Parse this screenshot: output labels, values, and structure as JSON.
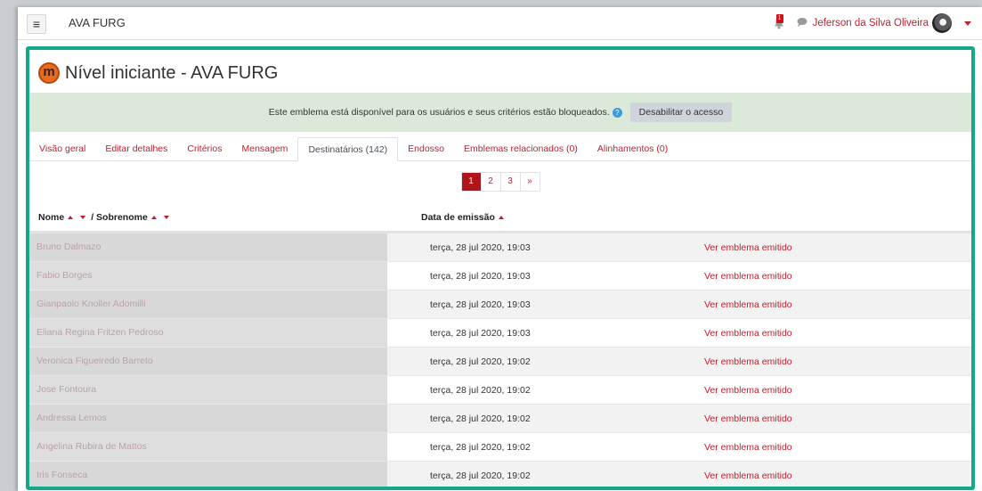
{
  "navbar": {
    "site_name": "AVA FURG",
    "notification_count": "1",
    "user_name": "Jeferson da Silva Oliveira"
  },
  "header": {
    "title": "Nível iniciante - AVA FURG"
  },
  "alert": {
    "message": "Este emblema está disponível para os usuários e seus critérios estão bloqueados.",
    "button_label": "Desabilitar o acesso"
  },
  "tabs": [
    {
      "label": "Visão geral"
    },
    {
      "label": "Editar detalhes"
    },
    {
      "label": "Critérios"
    },
    {
      "label": "Mensagem"
    },
    {
      "label": "Destinatários (142)",
      "active": true
    },
    {
      "label": "Endosso"
    },
    {
      "label": "Emblemas relacionados (0)"
    },
    {
      "label": "Alinhamentos (0)"
    }
  ],
  "pagination": {
    "pages": [
      "1",
      "2",
      "3"
    ],
    "next": "»",
    "current": "1"
  },
  "table": {
    "col_nome": "Nome",
    "col_sobrenome": "/ Sobrenome",
    "col_date": "Data de emissão",
    "rows": [
      {
        "name": "Bruno Dalmazo",
        "date": "terça, 28 jul 2020, 19:03",
        "link": "Ver emblema emitido"
      },
      {
        "name": "Fabio Borges",
        "date": "terça, 28 jul 2020, 19:03",
        "link": "Ver emblema emitido"
      },
      {
        "name": "Gianpaolo Knoller Adomilli",
        "date": "terça, 28 jul 2020, 19:03",
        "link": "Ver emblema emitido"
      },
      {
        "name": "Eliana Regina Fritzen Pedroso",
        "date": "terça, 28 jul 2020, 19:03",
        "link": "Ver emblema emitido"
      },
      {
        "name": "Veronica Figueiredo Barreto",
        "date": "terça, 28 jul 2020, 19:02",
        "link": "Ver emblema emitido"
      },
      {
        "name": "Jose Fontoura",
        "date": "terça, 28 jul 2020, 19:02",
        "link": "Ver emblema emitido"
      },
      {
        "name": "Andressa Lemos",
        "date": "terça, 28 jul 2020, 19:02",
        "link": "Ver emblema emitido"
      },
      {
        "name": "Angelina Rubira de Mattos",
        "date": "terça, 28 jul 2020, 19:02",
        "link": "Ver emblema emitido"
      },
      {
        "name": "Iris Fonseca",
        "date": "terça, 28 jul 2020, 19:02",
        "link": "Ver emblema emitido"
      }
    ]
  },
  "icons": {
    "menu": "hamburger-icon",
    "notifications": "bell-icon",
    "messages": "chat-bubble-icon",
    "user_menu": "chevron-down-icon",
    "badge": "moodle-badge-icon",
    "help": "help-icon"
  },
  "colors": {
    "accent": "#c0202d",
    "highlight_border": "#14a889",
    "alert_bg": "#dbe9d8",
    "current_page": "#b0151b"
  }
}
